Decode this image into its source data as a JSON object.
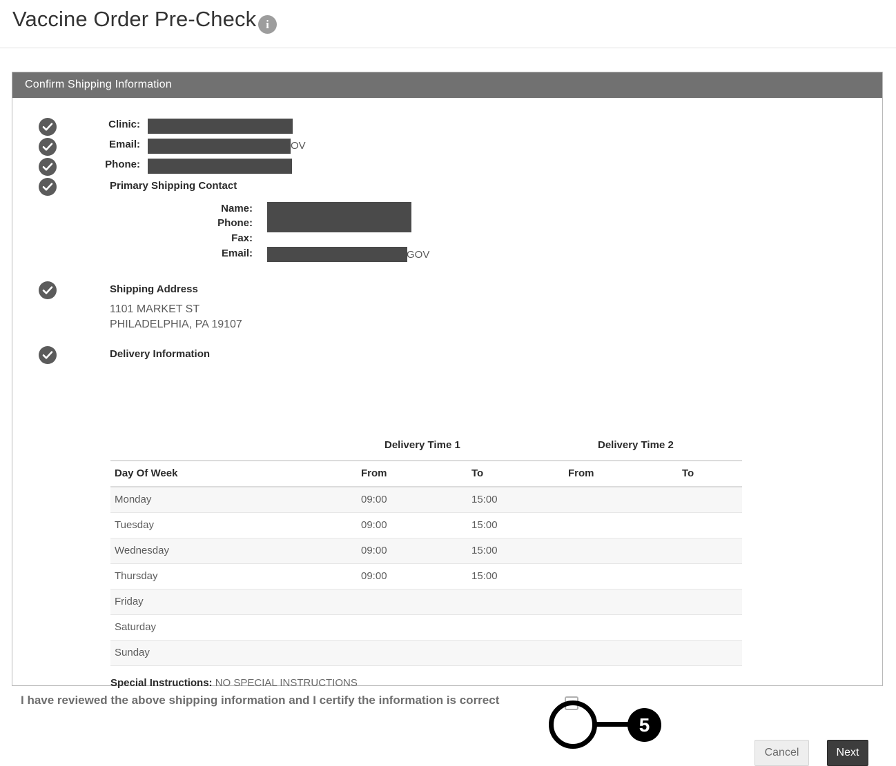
{
  "page": {
    "title": "Vaccine Order Pre-Check",
    "info_icon": "info-icon",
    "info_glyph": "i"
  },
  "card": {
    "header_title": "Confirm Shipping Information"
  },
  "clinic_info": {
    "fields": [
      {
        "label": "Clinic:",
        "redacted": true,
        "trailing": ""
      },
      {
        "label": "Email:",
        "redacted": true,
        "trailing": "OV"
      },
      {
        "label": "Phone:",
        "redacted": true,
        "trailing": ""
      }
    ]
  },
  "primary_shipping_contact": {
    "heading": "Primary Shipping Contact",
    "fields": [
      {
        "label": "Name:",
        "redacted": true,
        "trailing": ""
      },
      {
        "label": "Phone:",
        "redacted": true,
        "trailing": ""
      },
      {
        "label": "Fax:",
        "redacted": false,
        "trailing": ""
      },
      {
        "label": "Email:",
        "redacted": true,
        "trailing": "GOV"
      }
    ]
  },
  "shipping_address": {
    "heading": "Shipping Address",
    "line1": "1101 MARKET ST",
    "line2": "PHILADELPHIA, PA 19107"
  },
  "delivery_information": {
    "heading": "Delivery Information",
    "group_headers": [
      "Delivery Time 1",
      "Delivery Time 2"
    ],
    "columns": [
      "Day Of Week",
      "From",
      "To",
      "From",
      "To"
    ],
    "rows": [
      {
        "day": "Monday",
        "from1": "09:00",
        "to1": "15:00",
        "from2": "",
        "to2": ""
      },
      {
        "day": "Tuesday",
        "from1": "09:00",
        "to1": "15:00",
        "from2": "",
        "to2": ""
      },
      {
        "day": "Wednesday",
        "from1": "09:00",
        "to1": "15:00",
        "from2": "",
        "to2": ""
      },
      {
        "day": "Thursday",
        "from1": "09:00",
        "to1": "15:00",
        "from2": "",
        "to2": ""
      },
      {
        "day": "Friday",
        "from1": "",
        "to1": "",
        "from2": "",
        "to2": ""
      },
      {
        "day": "Saturday",
        "from1": "",
        "to1": "",
        "from2": "",
        "to2": ""
      },
      {
        "day": "Sunday",
        "from1": "",
        "to1": "",
        "from2": "",
        "to2": ""
      }
    ]
  },
  "special_instructions": {
    "label": "Special Instructions:",
    "value": "NO SPECIAL INSTRUCTIONS"
  },
  "certification": {
    "text": "I have reviewed the above shipping information and I certify the information is correct",
    "checked": false
  },
  "annotation": {
    "number": "5"
  },
  "buttons": {
    "cancel": "Cancel",
    "next": "Next"
  },
  "colors": {
    "card_header_bg": "#717171",
    "redaction": "#4a4a4a",
    "check_circle": "#5b5b5b",
    "next_button_bg": "#3d3d3d",
    "annotation": "#000000"
  }
}
